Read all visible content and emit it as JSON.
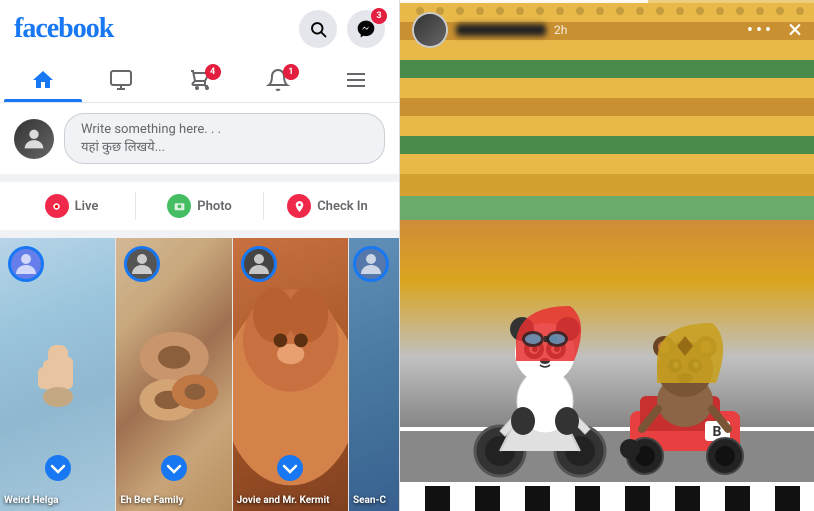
{
  "app": {
    "logo": "facebook",
    "title": "Facebook"
  },
  "header": {
    "logo_text": "facebook",
    "search_label": "Search",
    "messenger_label": "Messenger",
    "messenger_badge": "3"
  },
  "nav": {
    "items": [
      {
        "id": "home",
        "label": "Home",
        "icon": "🏠",
        "active": true
      },
      {
        "id": "watch",
        "label": "Watch",
        "icon": "▶",
        "active": false
      },
      {
        "id": "marketplace",
        "label": "Marketplace",
        "icon": "🛍",
        "active": false,
        "badge": "4"
      },
      {
        "id": "notifications",
        "label": "Notifications",
        "icon": "🔔",
        "active": false,
        "badge": "1"
      },
      {
        "id": "menu",
        "label": "Menu",
        "icon": "☰",
        "active": false
      }
    ]
  },
  "post_box": {
    "placeholder_line1": "Write something here. . .",
    "placeholder_line2": "यहां कुछ लिखये..."
  },
  "action_bar": {
    "live_label": "Live",
    "photo_label": "Photo",
    "checkin_label": "Check In"
  },
  "stories": [
    {
      "id": 1,
      "name": "Weird Helga",
      "bg": "light-blue"
    },
    {
      "id": 2,
      "name": "Eh Bee Family",
      "bg": "tan"
    },
    {
      "id": 3,
      "name": "Jovie and Mr. Kermit",
      "bg": "orange"
    },
    {
      "id": 4,
      "name": "Sean-C Van Do",
      "bg": "blue"
    }
  ],
  "story_viewer": {
    "username_blurred": true,
    "time": "2h",
    "more_icon": "•••",
    "close_icon": "×",
    "progress_pct": 60
  }
}
